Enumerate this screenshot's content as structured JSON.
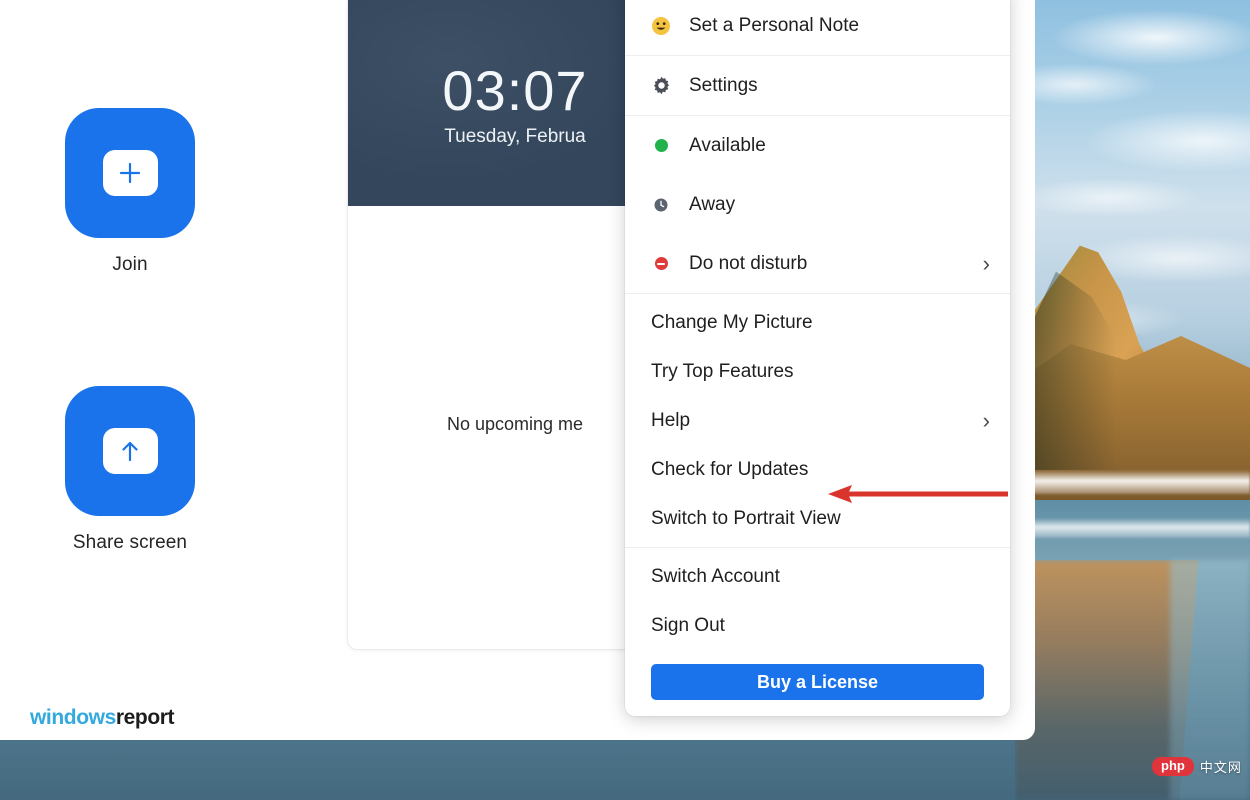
{
  "app": {
    "actions": [
      {
        "label": "Join",
        "icon": "plus-icon"
      },
      {
        "label": "Share screen",
        "icon": "upload-arrow-icon"
      }
    ],
    "meeting_card": {
      "time": "03:07",
      "date": "Tuesday, Februa",
      "empty_state": "No upcoming me"
    }
  },
  "menu": {
    "personal_note": {
      "label": "Set a Personal Note",
      "icon": "smiley-emoji-icon"
    },
    "settings": {
      "label": "Settings",
      "icon": "gear-icon"
    },
    "status": [
      {
        "label": "Available",
        "icon": "status-available-dot",
        "color": "#22b24c",
        "submenu": false
      },
      {
        "label": "Away",
        "icon": "status-away-clock-icon",
        "color": "#5b6270",
        "submenu": false
      },
      {
        "label": "Do not disturb",
        "icon": "status-dnd-dot",
        "color": "#e03b3b",
        "submenu": true
      }
    ],
    "general": [
      {
        "label": "Change My Picture",
        "submenu": false
      },
      {
        "label": "Try Top Features",
        "submenu": false
      },
      {
        "label": "Help",
        "submenu": true
      },
      {
        "label": "Check for Updates",
        "submenu": false
      },
      {
        "label": "Switch to Portrait View",
        "submenu": false
      }
    ],
    "account": [
      {
        "label": "Switch Account"
      },
      {
        "label": "Sign Out"
      }
    ],
    "buy_license_label": "Buy a License",
    "chevron": "›"
  },
  "annotation": {
    "arrow_color": "#d9352c",
    "points_to": "Check for Updates"
  },
  "watermarks": {
    "site_logo_part1": "windows",
    "site_logo_part2": "report",
    "php_badge": "php",
    "php_cn": "中文网"
  },
  "colors": {
    "accent_blue": "#1a73ea",
    "clock_banner": "#33465c"
  }
}
